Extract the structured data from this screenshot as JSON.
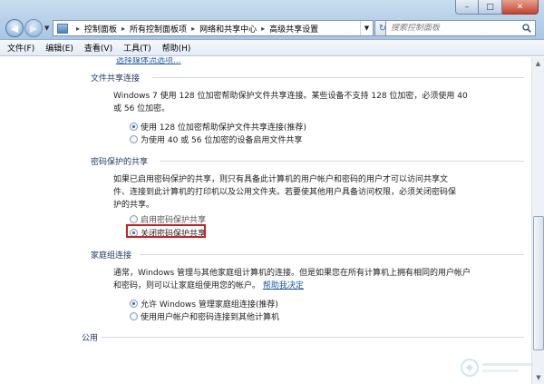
{
  "window": {
    "minimize": "–",
    "maximize": "□",
    "close": "✕"
  },
  "address": {
    "crumbs": [
      "控制面板",
      "所有控制面板项",
      "网络和共享中心",
      "高级共享设置"
    ]
  },
  "search": {
    "placeholder": "搜索控制面板"
  },
  "menu": [
    "文件(F)",
    "编辑(E)",
    "查看(V)",
    "工具(T)",
    "帮助(H)"
  ],
  "top_link": "选择媒体流选项...",
  "sections": {
    "file_sharing": {
      "title": "文件共享连接",
      "para": "Windows 7 使用 128 位加密帮助保护文件共享连接。某些设备不支持 128 位加密，必须使用 40 或 56 位加密。",
      "options": [
        {
          "label": "使用 128 位加密帮助保护文件共享连接(推荐)",
          "selected": true
        },
        {
          "label": "为使用 40 或 56 位加密的设备启用文件共享",
          "selected": false
        }
      ]
    },
    "password": {
      "title": "密码保护的共享",
      "para": "如果已启用密码保护的共享，则只有具备此计算机的用户帐户和密码的用户才可以访问共享文件、连接到此计算机的打印机以及公用文件夹。若要使其他用户具备访问权限，必须关闭密码保护的共享。",
      "options": [
        {
          "label": "启用密码保护共享",
          "selected": false
        },
        {
          "label": "关闭密码保护共享",
          "selected": true
        }
      ]
    },
    "homegroup": {
      "title": "家庭组连接",
      "para_prefix": "通常，Windows 管理与其他家庭组计算机的连接。但是如果您在所有计算机上拥有相同的用户帐户和密码，则可以让家庭组使用您的帐户。",
      "help_link": "帮助我决定",
      "options": [
        {
          "label": "允许 Windows 管理家庭组连接(推荐)",
          "selected": true
        },
        {
          "label": "使用用户帐户和密码连接到其他计算机",
          "selected": false
        }
      ]
    },
    "public": {
      "title": "公用"
    }
  },
  "icons": {
    "back": "arrow-left-icon",
    "forward": "arrow-right-icon",
    "refresh": "refresh-icon",
    "search": "search-icon"
  }
}
